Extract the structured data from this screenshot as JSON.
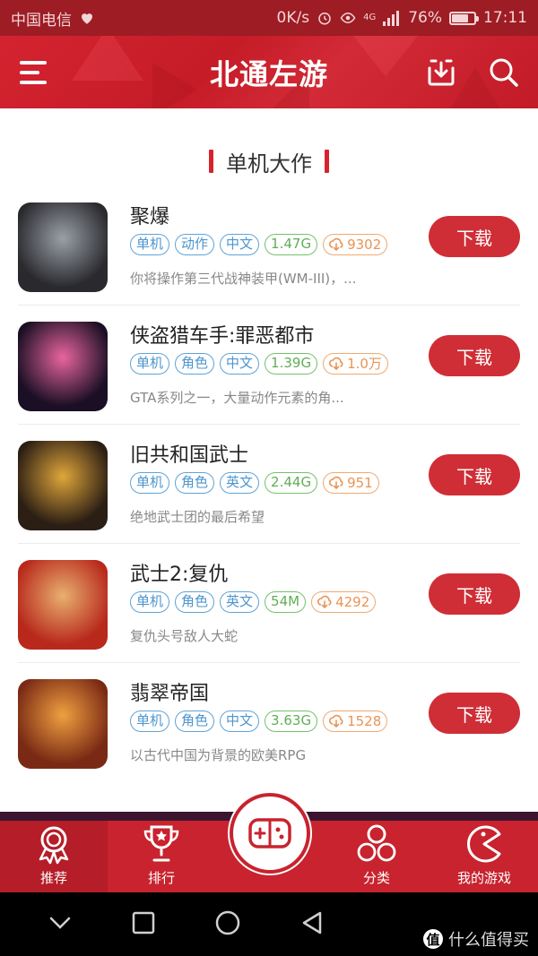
{
  "status_bar": {
    "carrier": "中国电信",
    "speed": "0K/s",
    "network": "4G",
    "battery": "76%",
    "battery_level": 0.76,
    "time": "17:11"
  },
  "header": {
    "title": "北通左游",
    "icons": [
      "menu-icon",
      "download-manager-icon",
      "search-icon"
    ]
  },
  "section": {
    "title": "单机大作"
  },
  "games": [
    {
      "name": "聚爆",
      "tags": [
        "单机",
        "动作",
        "中文"
      ],
      "size": "1.47G",
      "downloads": "9302",
      "desc": "你将操作第三代战神装甲(WM-III)，...",
      "button": "下载",
      "icon_colors": [
        "#2a2a2e",
        "#9aa0a8"
      ]
    },
    {
      "name": "侠盗猎车手:罪恶都市",
      "tags": [
        "单机",
        "角色",
        "中文"
      ],
      "size": "1.39G",
      "downloads": "1.0万",
      "desc": "GTA系列之一，大量动作元素的角...",
      "button": "下载",
      "icon_colors": [
        "#1a0f24",
        "#e8659f"
      ]
    },
    {
      "name": "旧共和国武士",
      "tags": [
        "单机",
        "角色",
        "英文"
      ],
      "size": "2.44G",
      "downloads": "951",
      "desc": "绝地武士团的最后希望",
      "button": "下载",
      "icon_colors": [
        "#2b1e14",
        "#e0a63a"
      ]
    },
    {
      "name": "武士2:复仇",
      "tags": [
        "单机",
        "角色",
        "英文"
      ],
      "size": "54M",
      "downloads": "4292",
      "desc": "复仇头号敌人大蛇",
      "button": "下载",
      "icon_colors": [
        "#b8291c",
        "#e8b070"
      ]
    },
    {
      "name": "翡翠帝国",
      "tags": [
        "单机",
        "角色",
        "中文"
      ],
      "size": "3.63G",
      "downloads": "1528",
      "desc": "以古代中国为背景的欧美RPG",
      "button": "下载",
      "icon_colors": [
        "#7a2a14",
        "#f0a040"
      ]
    }
  ],
  "tabs": [
    {
      "label": "推荐",
      "icon": "medal-icon",
      "active": true
    },
    {
      "label": "排行",
      "icon": "trophy-icon",
      "active": false
    },
    {
      "label": "",
      "icon": "gamepad-icon",
      "active": false
    },
    {
      "label": "分类",
      "icon": "category-icon",
      "active": false
    },
    {
      "label": "我的游戏",
      "icon": "pacman-icon",
      "active": false
    }
  ],
  "watermark": {
    "text": "什么值得买",
    "logo": "值"
  },
  "colors": {
    "brand_red": "#c8232e",
    "status_bar": "#9e1c24",
    "tag_blue": "#4d95cd",
    "tag_green": "#5fae55",
    "tag_orange": "#e99455"
  }
}
